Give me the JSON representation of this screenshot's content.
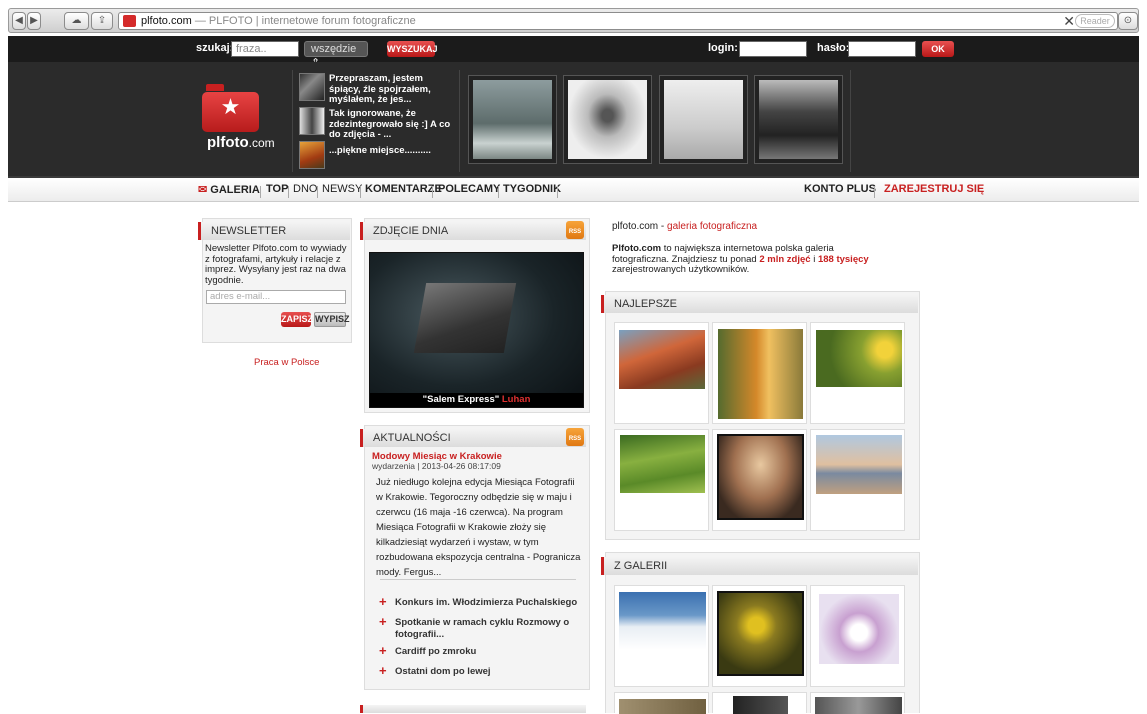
{
  "browser": {
    "url": "plfoto.com",
    "page_title": "— PLFOTO | internetowe forum fotograficzne",
    "reader_label": "Reader",
    "back_glyph": "◀",
    "forward_glyph": "▶",
    "cloud_glyph": "☁",
    "share_glyph": "⇪",
    "clear_glyph": "✕",
    "ext_glyph": "⊙"
  },
  "topbar": {
    "search_label": "szukaj:",
    "search_placeholder": "fraza..",
    "scope_select": "wszędzie",
    "search_button": "WYSZUKAJ",
    "login_label": "login:",
    "password_label": "hasło:",
    "ok_button": "OK"
  },
  "logo": {
    "name": "plfoto",
    "suffix": ".com",
    "star": "★"
  },
  "header_comments": [
    {
      "text": "Przepraszam, jestem śpiący, źle spojrzałem, myślałem, że jes..."
    },
    {
      "text": "Tak ignorowane, że zdezintegrowało się :] A co do zdjęcia - ..."
    },
    {
      "text": "...piękne miejsce.........."
    }
  ],
  "nav": {
    "items": [
      "GALERIA",
      "TOP",
      "DNO",
      "NEWSY",
      "KOMENTARZE",
      "POLECAMY",
      "TYGODNIK"
    ],
    "konto_plus": "KONTO PLUS",
    "register": "ZAREJESTRUJ SIĘ"
  },
  "newsletter": {
    "title": "NEWSLETTER",
    "text": "Newsletter Plfoto.com to wywiady z fotografami, artykuły i relacje z imprez. Wysyłany jest raz na dwa tygodnie.",
    "email_placeholder": "adres e-mail...",
    "subscribe_button": "ZAPISZ",
    "unsubscribe_button": "WYPISZ"
  },
  "praca_link": "Praca w Polsce",
  "photo_of_day": {
    "title": "ZDJĘCIE DNIA",
    "caption": "\"Salem Express\"",
    "author": "Luhan",
    "rss": "RSS"
  },
  "news": {
    "title": "AKTUALNOŚCI",
    "headline": "Modowy Miesiąc w Krakowie",
    "meta": "wydarzenia | 2013-04-26 08:17:09",
    "body": "Już niedługo kolejna edycja Miesiąca Fotografii w Krakowie. Tegoroczny odbędzie się w maju i czerwcu (16 maja -16 czerwca). Na program Miesiąca Fotografii w Krakowie złoży się kilkadziesiąt wydarzeń i wystaw, w tym rozbudowana ekspozycja centralna - Pogranicza mody.  Fergus...",
    "rss": "RSS",
    "links": [
      "Konkurs im. Włodzimierza Puchalskiego",
      "Spotkanie w ramach cyklu Rozmowy o fotografii...",
      "Cardiff po zmroku",
      "Ostatni dom po lewej"
    ]
  },
  "about": {
    "site": "plfoto.com",
    "subtitle": "galeria fotograficzna",
    "brand": "Plfoto.com",
    "text_1": " to największa internetowa polska galeria fotograficzna. Znajdziesz tu ponad ",
    "photos_count": "2 mln zdjęć",
    "text_2": " i ",
    "users_count": "188 tysięcy",
    "text_3": " zarejestrowanych użytkowników."
  },
  "best": {
    "title": "NAJLEPSZE"
  },
  "from_gallery": {
    "title": "Z GALERII"
  }
}
